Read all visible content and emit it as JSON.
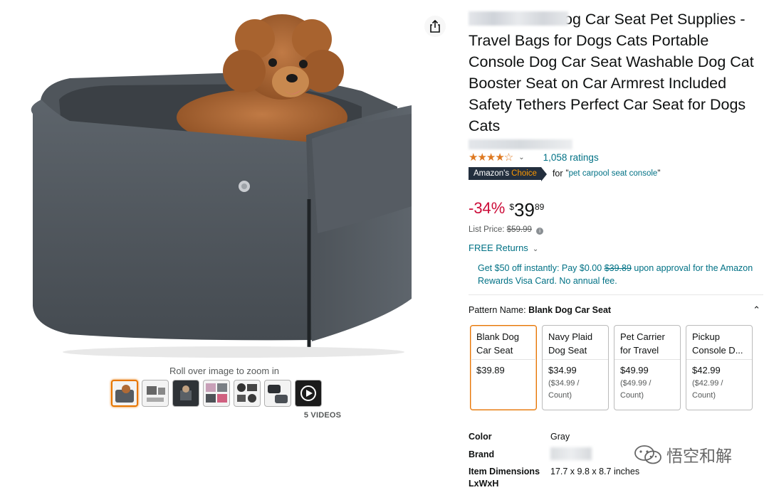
{
  "gallery": {
    "zoom_hint": "Roll over image to zoom in",
    "videos_label": "5 VIDEOS",
    "share_icon": "share-icon"
  },
  "product": {
    "title": "og Car Seat Pet Supplies - Travel Bags for Dogs Cats Portable Console Dog Car Seat Washable Dog Cat Booster Seat on Car Armrest Included Safety Tethers Perfect Car Seat for Dogs Cats",
    "stars_display": "★★★★☆",
    "ratings_text": "1,058 ratings",
    "choice_badge": {
      "prefix": "Amazon's",
      "word": "Choice"
    },
    "choice_for": "for",
    "choice_keyword": "pet carpool seat console",
    "discount": "-34%",
    "price_symbol": "$",
    "price_whole": "39",
    "price_fraction": "89",
    "list_price_label": "List Price:",
    "list_price": "$59.99",
    "free_returns": "FREE Returns",
    "promo_before": "Get $50 off instantly: Pay $0.00",
    "promo_strike": "$39.89",
    "promo_after": "upon approval for the Amazon Rewards Visa Card. No annual fee.",
    "pattern_label": "Pattern Name:",
    "pattern_value": "Blank Dog Car Seat"
  },
  "swatches": [
    {
      "name": "Blank Dog Car Seat",
      "price": "$39.89",
      "unit": ""
    },
    {
      "name": "Navy Plaid Dog Seat",
      "price": "$34.99",
      "unit": "($34.99 / Count)"
    },
    {
      "name": "Pet Carrier for Travel",
      "price": "$49.99",
      "unit": "($49.99 / Count)"
    },
    {
      "name": "Pickup Console D...",
      "price": "$42.99",
      "unit": "($42.99 / Count)"
    }
  ],
  "specs": {
    "color_label": "Color",
    "color_value": "Gray",
    "brand_label": "Brand",
    "dims_label": "Item Dimensions",
    "dims_label2": "LxWxH",
    "dims_value": "17.7 x 9.8 x 8.7 inches"
  },
  "watermark": {
    "text": "悟空和解"
  },
  "colors": {
    "accent": "#e77600",
    "link": "#007185",
    "discount": "#cc0c39",
    "star": "#de7921"
  }
}
